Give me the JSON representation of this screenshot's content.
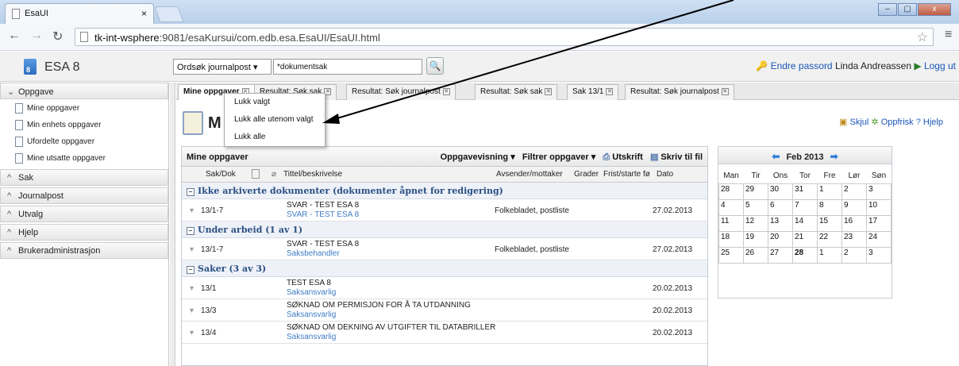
{
  "browser": {
    "tab_title": "EsaUI",
    "tab_close": "×",
    "url_host": "tk-int-wsphere",
    "url_rest": ":9081/esaKursui/com.edb.esa.EsaUI/EsaUI.html",
    "window_controls": [
      "–",
      "▢",
      "x"
    ]
  },
  "app": {
    "name": "ESA 8",
    "logo_text": "8",
    "search_select": "Ordsøk journalpost",
    "search_value": "*dokumentsak",
    "change_password": "Endre passord",
    "user": "Linda Andreassen",
    "logout": "Logg ut"
  },
  "sidebar": {
    "oppgave": "Oppgave",
    "items": [
      "Mine oppgaver",
      "Min enhets oppgaver",
      "Ufordelte oppgaver",
      "Mine utsatte oppgaver"
    ],
    "sections": [
      "Sak",
      "Journalpost",
      "Utvalg",
      "Hjelp",
      "Brukeradministrasjon"
    ]
  },
  "tabs": [
    "Mine oppgaver",
    "Resultat: Søk sak",
    "Resultat: Søk journalpost",
    "Resultat: Søk sak",
    "Sak 13/1",
    "Resultat: Søk journalpost"
  ],
  "context_menu": [
    "Lukk valgt",
    "Lukk alle utenom valgt",
    "Lukk alle"
  ],
  "page": {
    "title": "Mine oppgaver",
    "title_visible": "M",
    "hide": "Skjul",
    "refresh": "Oppfrisk",
    "help": "Hjelp"
  },
  "list": {
    "title": "Mine oppgaver",
    "view": "Oppgavevisning",
    "filter": "Filtrer oppgaver",
    "print": "Utskrift",
    "write_file": "Skriv til fil",
    "columns": [
      "Sak/Dok",
      "Tittel/beskrivelse",
      "Avsender/mottaker",
      "Grader",
      "Frist/starte fø",
      "Dato"
    ],
    "groups": [
      {
        "label": "Ikke arkiverte dokumenter (dokumenter åpnet for redigering)",
        "rows": [
          {
            "id": "13/1-7",
            "title": "SVAR - TEST ESA 8",
            "sub": "SVAR - TEST ESA 8",
            "sender": "Folkebladet, postliste",
            "date": "27.02.2013"
          }
        ]
      },
      {
        "label": "Under arbeid (1 av 1)",
        "rows": [
          {
            "id": "13/1-7",
            "title": "SVAR - TEST ESA 8",
            "sub": "Saksbehandler",
            "sender": "Folkebladet, postliste",
            "date": "27.02.2013"
          }
        ]
      },
      {
        "label": "Saker (3 av 3)",
        "rows": [
          {
            "id": "13/1",
            "title": "TEST ESA 8",
            "sub": "Saksansvarlig",
            "sender": "",
            "date": "20.02.2013"
          },
          {
            "id": "13/3",
            "title": "SØKNAD OM PERMISJON FOR Å TA UTDANNING",
            "sub": "Saksansvarlig",
            "sender": "",
            "date": "20.02.2013"
          },
          {
            "id": "13/4",
            "title": "SØKNAD OM DEKNING AV UTGIFTER TIL DATABRILLER",
            "sub": "Saksansvarlig",
            "sender": "",
            "date": "20.02.2013"
          }
        ]
      }
    ]
  },
  "calendar": {
    "month": "Feb 2013",
    "days": [
      "Man",
      "Tir",
      "Ons",
      "Tor",
      "Fre",
      "Lør",
      "Søn"
    ],
    "weeks": [
      [
        "28",
        "29",
        "30",
        "31",
        "1",
        "2",
        "3"
      ],
      [
        "4",
        "5",
        "6",
        "7",
        "8",
        "9",
        "10"
      ],
      [
        "11",
        "12",
        "13",
        "14",
        "15",
        "16",
        "17"
      ],
      [
        "18",
        "19",
        "20",
        "21",
        "22",
        "23",
        "24"
      ],
      [
        "25",
        "26",
        "27",
        "28",
        "1",
        "2",
        "3"
      ]
    ]
  }
}
